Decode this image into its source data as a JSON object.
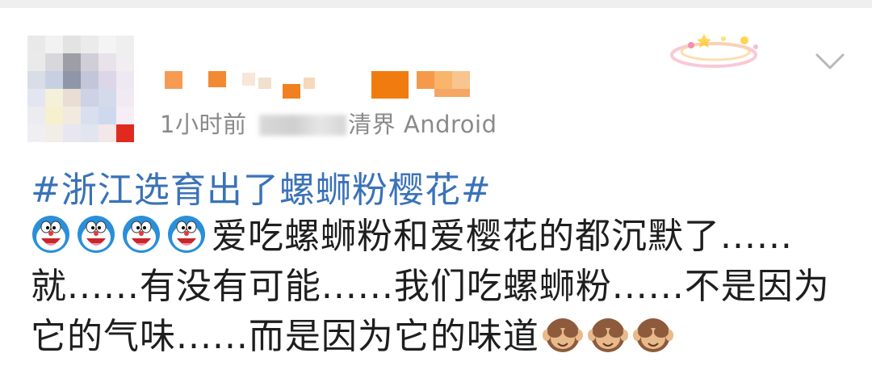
{
  "post": {
    "username": "",
    "timestamp": "1小时前",
    "source_prefix": "来自",
    "source_suffix": "清界 Android",
    "topic": "#浙江选育出了螺蛳粉樱花#",
    "line1": "爱吃螺蛳粉和爱樱花的都沉默了......",
    "line2": "就......有没有可能......我们吃螺蛳粉......不是因为",
    "line3": "它的气味......而是因为它的味道",
    "leading_emojis": [
      "doraemon-face",
      "doraemon-face",
      "doraemon-face",
      "doraemon-face"
    ],
    "trailing_emojis": [
      "see-no-evil-monkey",
      "see-no-evil-monkey",
      "see-no-evil-monkey"
    ]
  },
  "colors": {
    "topic": "#3a72b8",
    "body_text": "#1e1e1e",
    "meta_text": "#8a8a8a"
  },
  "icons": {
    "menu": "chevron-down-icon",
    "badge": "fan-badge-decoration"
  }
}
